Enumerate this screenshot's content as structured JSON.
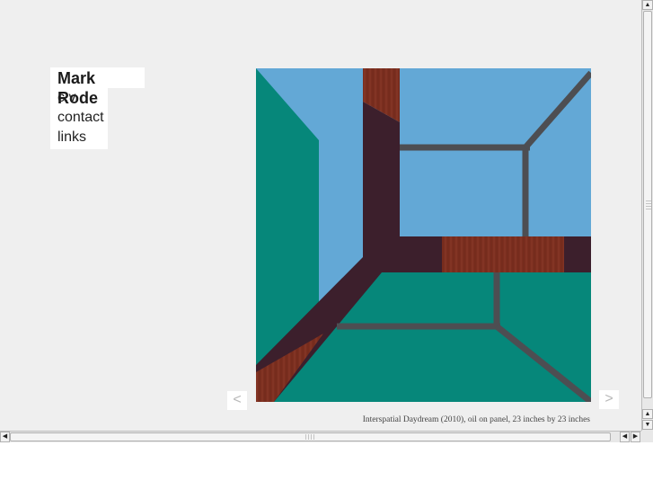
{
  "nav": {
    "title": "Mark Rode",
    "items": [
      {
        "label": "c.v."
      },
      {
        "label": "contact"
      },
      {
        "label": "links"
      }
    ]
  },
  "artwork": {
    "caption": "Interspatial Daydream (2010), oil on panel, 23 inches by 23 inches"
  },
  "controls": {
    "prev_label": "<",
    "next_label": ">"
  },
  "icons": {
    "scroll_up": "triangle-up-icon",
    "scroll_down": "triangle-down-icon",
    "scroll_left": "triangle-left-icon",
    "scroll_right": "triangle-right-icon"
  },
  "colors": {
    "background": "#efefef",
    "sky_blue": "#63a8d6",
    "teal": "#06877a",
    "aubergine": "#3c1f2c",
    "wood": "#7b2e1f",
    "grey_line": "#4d4e52"
  }
}
